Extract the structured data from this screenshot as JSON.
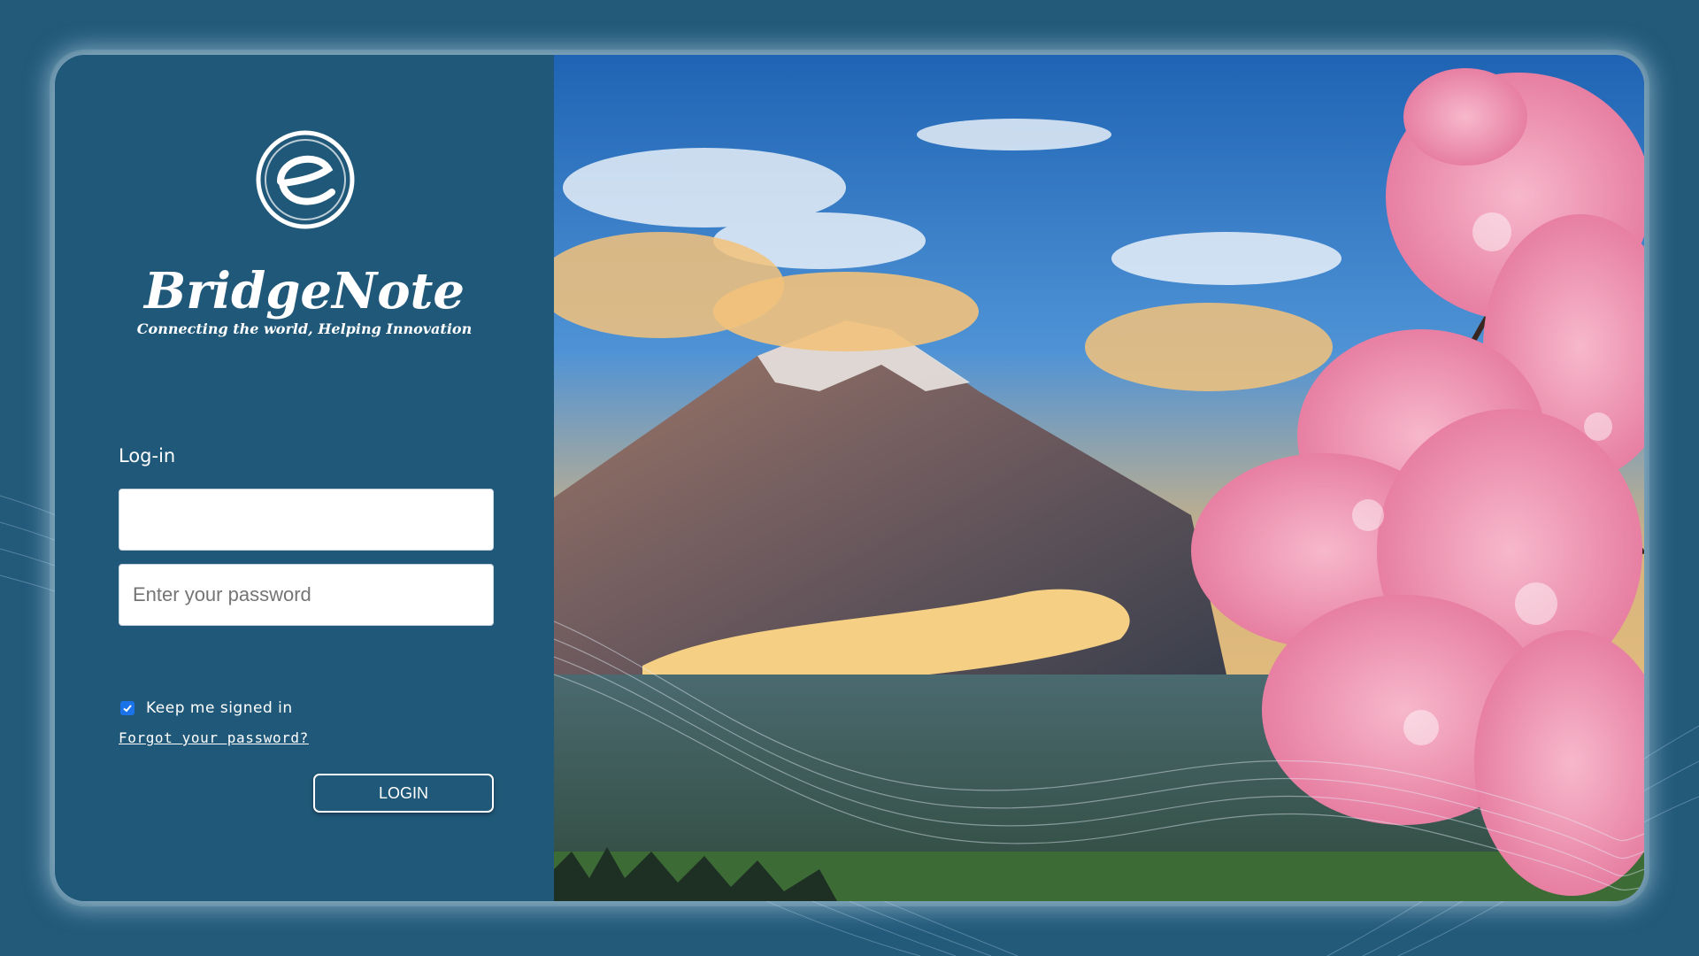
{
  "brand": {
    "name": "BridgeNote",
    "tagline": "Connecting the world, Helping Innovation"
  },
  "login_form": {
    "heading": "Log-in",
    "username_value": "",
    "password_placeholder": "Enter your password",
    "keep_signed_in_label": "Keep me signed in",
    "keep_signed_in_checked": true,
    "forgot_password_label": "Forgot your password?",
    "login_button_label": "LOGIN"
  },
  "colors": {
    "page_background": "#235a7a",
    "panel_background": "#205879",
    "checkbox_accent": "#1a73e8",
    "text": "#ffffff"
  },
  "hero_image": {
    "icon": "mount-fuji-cherry-blossom-image"
  }
}
